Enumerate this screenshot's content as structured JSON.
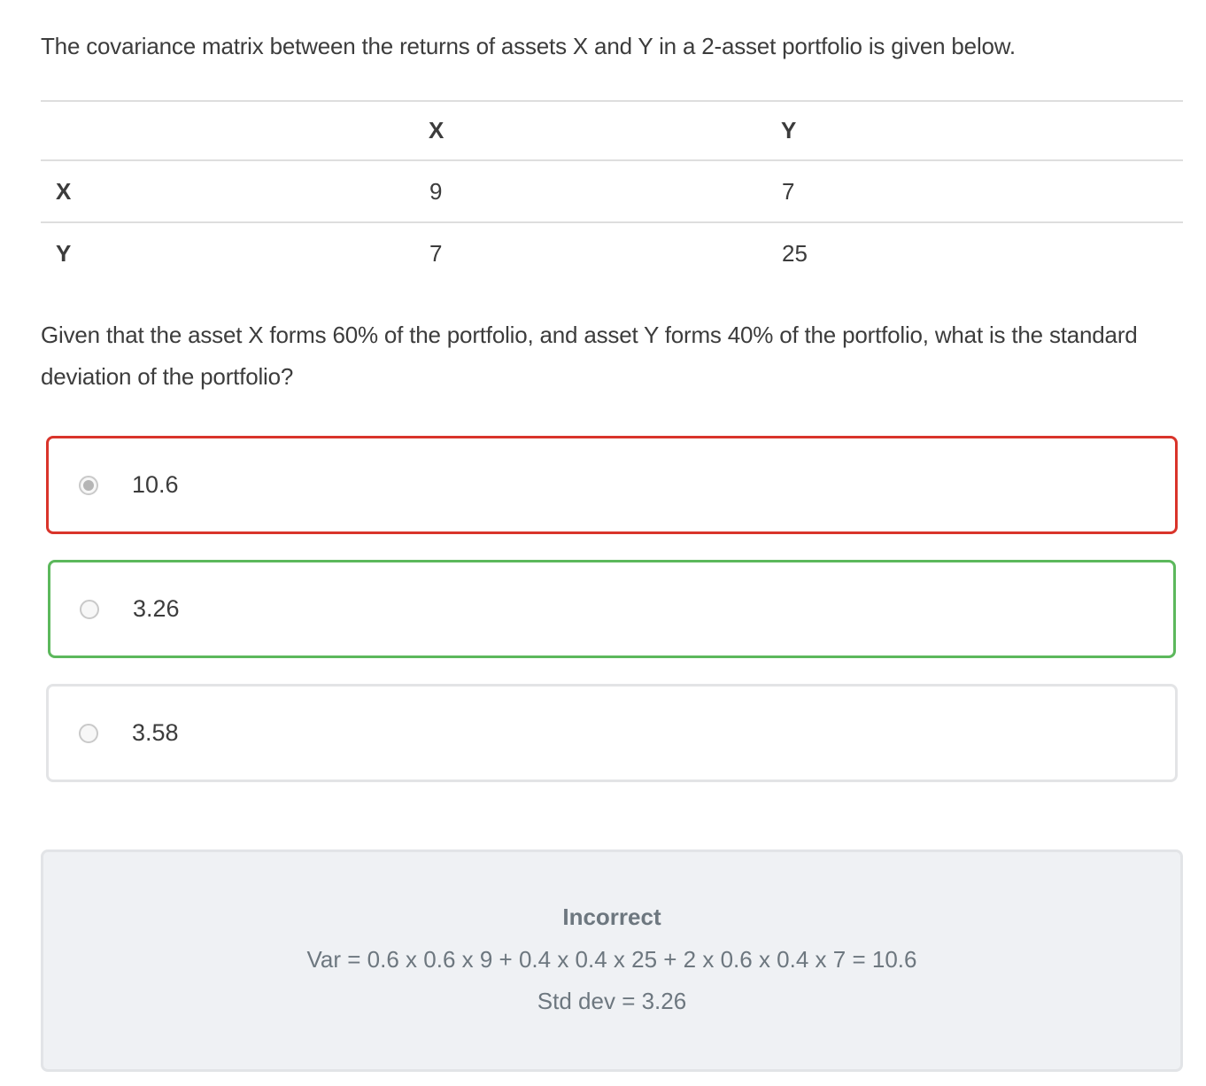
{
  "intro_text": "The covariance matrix between the returns of assets X and Y in a 2-asset portfolio is given below.",
  "matrix": {
    "col_headers": [
      "",
      "X",
      "Y"
    ],
    "rows": [
      {
        "label": "X",
        "values": [
          "9",
          "7"
        ]
      },
      {
        "label": "Y",
        "values": [
          "7",
          "25"
        ]
      }
    ]
  },
  "question_text": "Given that the asset X forms 60% of the portfolio, and asset Y forms 40% of the portfolio, what is the standard deviation of the portfolio?",
  "options": [
    {
      "label": "10.6",
      "selected": true,
      "state": "incorrect"
    },
    {
      "label": "3.26",
      "selected": false,
      "state": "correct"
    },
    {
      "label": "3.58",
      "selected": false,
      "state": "neutral"
    }
  ],
  "feedback": {
    "status": "Incorrect",
    "line1": "Var = 0.6 x 0.6 x 9 + 0.4 x 0.4 x 25 + 2 x 0.6 x 0.4 x 7 = 10.6",
    "line2": "Std dev = 3.26"
  },
  "colors": {
    "incorrect_border": "#d9342b",
    "correct_border": "#5cb85c",
    "neutral_border": "#e3e4e6",
    "feedback_bg": "#eff1f4"
  }
}
